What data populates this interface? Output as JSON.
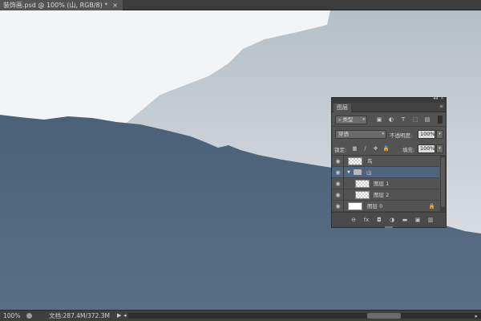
{
  "tab": {
    "title": "装饰画.psd @ 100% (山, RGB/8) *",
    "close": "×"
  },
  "colors": {
    "canvas_bg": "#f3f4f5",
    "far_mountain": "#b7c1ca",
    "near_mountain": "#4e6780",
    "selected_layer": "#4f657f"
  },
  "layers_panel": {
    "top_icons": {
      "collapse": "◂◂",
      "close": "×"
    },
    "tab_label": "图层",
    "menu_icon": "≡",
    "kind_label": "类型",
    "kind_icon": "⌕",
    "blend_mode": "穿透",
    "opacity_label": "不透明度:",
    "opacity_value": "100%",
    "lock_label": "锁定:",
    "fill_label": "填充:",
    "fill_value": "100%",
    "caret": "▾",
    "filter_icons": [
      "▣",
      "◐",
      "T",
      "⬚",
      "▤"
    ],
    "lock_icons": [
      "▦",
      "∕",
      "✥",
      "🔒"
    ],
    "layers": [
      {
        "name": "鸟",
        "indent": 0,
        "type": "pixel",
        "selected": false
      },
      {
        "name": "山",
        "indent": 0,
        "type": "group",
        "selected": true
      },
      {
        "name": "图层 1",
        "indent": 1,
        "type": "pixel",
        "selected": false
      },
      {
        "name": "图层 2",
        "indent": 1,
        "type": "pixel",
        "selected": false
      },
      {
        "name": "图层 0",
        "indent": 0,
        "type": "white",
        "selected": false,
        "locked": true
      }
    ],
    "eye_icon": "◉",
    "twirl_icon": "▼",
    "lock_icon": "🔒",
    "footer_icons": [
      "⊖",
      "fx",
      "◘",
      "◑",
      "▬",
      "▣",
      "▥"
    ]
  },
  "status_bar": {
    "zoom": "100%",
    "doc_info": "文档:287.4M/372.3M",
    "arrow_right": "▶",
    "arrow_left": "◂",
    "scroll_right": "▸"
  }
}
